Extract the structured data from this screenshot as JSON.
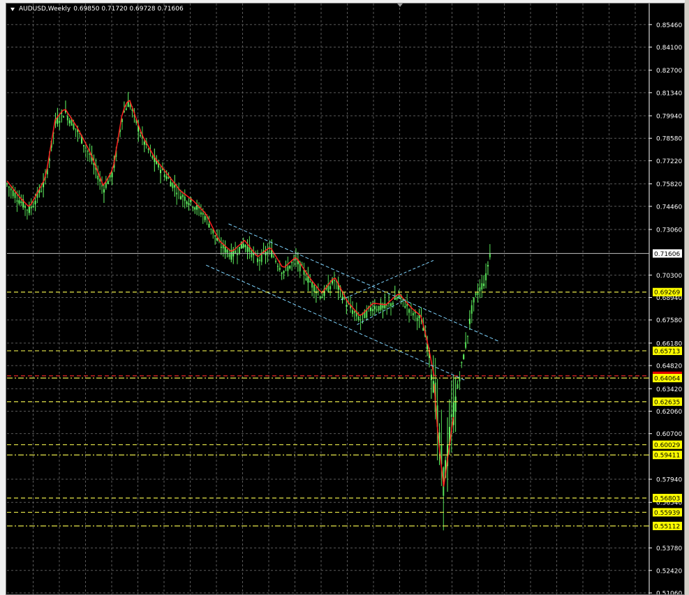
{
  "window": {
    "symbol_title": "AUDUSD,Weekly",
    "ohlc": "0.69850 0.71720 0.69728 0.71606"
  },
  "colors": {
    "background": "#000000",
    "grid": "#5a5a5a",
    "candle_up": "#66ff66",
    "candle_down": "#55dd55",
    "moving_average": "#ff2020",
    "channel": "#7fd4ff",
    "level_line": "#e8e84a",
    "pivot_line": "#ff2a2a",
    "price_label_bg": "#ffff00",
    "current_price_label_bg": "#ffffff",
    "red_label_bg": "#e10000"
  },
  "chart_data": {
    "type": "candlestick",
    "symbol": "AUDUSD",
    "timeframe": "Weekly",
    "ylim": [
      0.5106,
      0.8602
    ],
    "y_ticks": [
      "0.85460",
      "0.84100",
      "0.82700",
      "0.81340",
      "0.79940",
      "0.78580",
      "0.77220",
      "0.75820",
      "0.74460",
      "0.73060",
      "0.70300",
      "0.68940",
      "0.67580",
      "0.66180",
      "0.64820",
      "0.63420",
      "0.62060",
      "0.60700",
      "0.57940",
      "0.56540",
      "0.53780",
      "0.52420",
      "0.51060"
    ],
    "current_price": "0.71606",
    "levels": [
      {
        "value": "0.69269",
        "style": "dashed",
        "label": "yellow"
      },
      {
        "value": "0.65713",
        "style": "dashed",
        "label": "yellow"
      },
      {
        "value": "0.64200",
        "style": "dashed-red",
        "label": "red"
      },
      {
        "value": "0.64064",
        "style": "dash-dot",
        "label": "yellow"
      },
      {
        "value": "0.62635",
        "style": "dashed",
        "label": "yellow"
      },
      {
        "value": "0.60029",
        "style": "dashed",
        "label": "yellow"
      },
      {
        "value": "0.59411",
        "style": "dash-dot",
        "label": "yellow"
      },
      {
        "value": "0.56803",
        "style": "dashed",
        "label": "yellow"
      },
      {
        "value": "0.55939",
        "style": "dashed",
        "label": "yellow"
      },
      {
        "value": "0.55112",
        "style": "dash-dot",
        "label": "yellow"
      }
    ],
    "price_path": [
      [
        0,
        0.758
      ],
      [
        0.02,
        0.748
      ],
      [
        0.035,
        0.742
      ],
      [
        0.06,
        0.76
      ],
      [
        0.075,
        0.795
      ],
      [
        0.09,
        0.802
      ],
      [
        0.11,
        0.79
      ],
      [
        0.13,
        0.775
      ],
      [
        0.15,
        0.755
      ],
      [
        0.165,
        0.765
      ],
      [
        0.18,
        0.8
      ],
      [
        0.19,
        0.808
      ],
      [
        0.21,
        0.786
      ],
      [
        0.23,
        0.772
      ],
      [
        0.25,
        0.762
      ],
      [
        0.27,
        0.752
      ],
      [
        0.29,
        0.746
      ],
      [
        0.31,
        0.738
      ],
      [
        0.33,
        0.722
      ],
      [
        0.35,
        0.715
      ],
      [
        0.37,
        0.722
      ],
      [
        0.39,
        0.712
      ],
      [
        0.41,
        0.718
      ],
      [
        0.43,
        0.705
      ],
      [
        0.45,
        0.712
      ],
      [
        0.47,
        0.7
      ],
      [
        0.49,
        0.69
      ],
      [
        0.51,
        0.7
      ],
      [
        0.53,
        0.685
      ],
      [
        0.55,
        0.676
      ],
      [
        0.57,
        0.684
      ],
      [
        0.59,
        0.683
      ],
      [
        0.61,
        0.69
      ],
      [
        0.63,
        0.681
      ],
      [
        0.645,
        0.676
      ],
      [
        0.655,
        0.66
      ],
      [
        0.665,
        0.64
      ],
      [
        0.672,
        0.605
      ],
      [
        0.68,
        0.578
      ],
      [
        0.688,
        0.6
      ],
      [
        0.695,
        0.62
      ],
      [
        0.705,
        0.642
      ],
      [
        0.715,
        0.662
      ],
      [
        0.725,
        0.685
      ],
      [
        0.735,
        0.694
      ],
      [
        0.745,
        0.7
      ],
      [
        0.752,
        0.716
      ]
    ],
    "channel": {
      "upper": [
        [
          0.345,
          0.734
        ],
        [
          0.765,
          0.663
        ]
      ],
      "lower": [
        [
          0.31,
          0.709
        ],
        [
          0.715,
          0.639
        ]
      ]
    }
  }
}
